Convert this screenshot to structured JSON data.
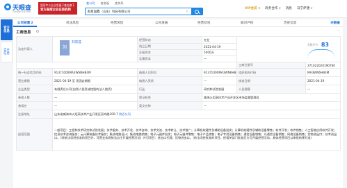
{
  "header": {
    "logo": "天眼查",
    "logo_url": "TianYanCha.com",
    "gov_badge_line1": "国家中小企业发展子基金旗下",
    "gov_badge_line2": "官方备案企业征信机构",
    "search_tabs": [
      "查公司",
      "查老板",
      "查关系"
    ],
    "search_value": "群星国鑫（山东）科技有限公司",
    "nav": [
      "VIP会员",
      "商务合作",
      "消息",
      "马宁萨唐"
    ]
  },
  "side": {
    "items": [
      "官方信息",
      "自主信息"
    ]
  },
  "tabs": [
    {
      "label": "公司背景",
      "badge": "2"
    },
    {
      "label": "司法风险",
      "badge": ""
    },
    {
      "label": "经营风险",
      "badge": ""
    },
    {
      "label": "公司发展",
      "badge": ""
    },
    {
      "label": "经营状况",
      "badge": ""
    },
    {
      "label": "知识产权",
      "badge": ""
    },
    {
      "label": "历史信息",
      "badge": ""
    }
  ],
  "brand_mini": "天眼查",
  "section": {
    "title": "工商信息",
    "right_label": "一"
  },
  "info": {
    "legal_rep_key": "法定代表人",
    "legal_avatar_char": "刘",
    "legal_name": "刘宗成",
    "status_key": "经营状态",
    "status_val": "在业",
    "est_date_key": "成立日期",
    "est_date_val": "2021-04-19",
    "reg_cap_key": "注册资本",
    "reg_cap_val": "5000万",
    "paid_cap_key": "实缴资本",
    "paid_cap_val": "一",
    "score_label": "天眼评分",
    "score": "83",
    "biz_reg_no_key": "工商注册号",
    "biz_reg_no_val": "371022020190760",
    "credit_code_key": "统一社会信用代码",
    "credit_code_val": "91371000MA3WN6HB4M",
    "taxpayer_id_key": "纳税人识别号",
    "taxpayer_id_val": "91371000MA3WN6HB4M",
    "org_code_key": "组织机构代码",
    "org_code_val": "MA3WN6HB4M",
    "term_key": "营业期限",
    "term_val": "2021-04-19 至 无固定期限",
    "taxpayer_q_key": "纳税人资质",
    "taxpayer_q_val": "一",
    "approve_date_key": "核准日期",
    "approve_date_val": "2021-04-19",
    "type_key": "企业类型",
    "type_val": "有限责任公司(自然人投资或控股的法人独资)",
    "industry_key": "行业",
    "industry_val": "研究和试验发展",
    "staff_key": "人员规模",
    "staff_val": "一",
    "insured_key": "参保人数",
    "insured_val": "一",
    "authority_key": "登记机关",
    "authority_val": "威海火炬高技术产业开发区市场监督管理局",
    "former_name_key": "曾用名",
    "former_name_val": "一",
    "en_name_key": "英文名称",
    "en_name_val": "一",
    "address_key": "注册地址",
    "address_val": "山东省威海市火炬高技术产业开发区双岛路300-7",
    "address_link": "附近公司",
    "scope_key": "经营范围",
    "scope_val": "一般项目：工程和技术研究和试验发展；技术服务、技术开发、技术咨询、技术交流、技术转让、技术推广；计算机软硬件及辅助设备批发；计算机软硬件及辅助设备零售；软件开发；软件销售；人工智能应用软件开发；信息技术咨询服务；云计算装备技术服务；集成电路设计；集成电路销售；电子元器件批发；电子元器件零售；电子产品销售；电子专用设备销售；通信设备销售；光通信设备销售；网络设备销售；货物进出口；技术进出口。（除依法须经批准的项目外，凭营业执照依法自主开展经营活动）许可项目：进出口代理；货物进出口。（依法须经批准的项目，经相关部门批准后方可开展经营活动，具体经营项目以审批结果为准）"
  }
}
